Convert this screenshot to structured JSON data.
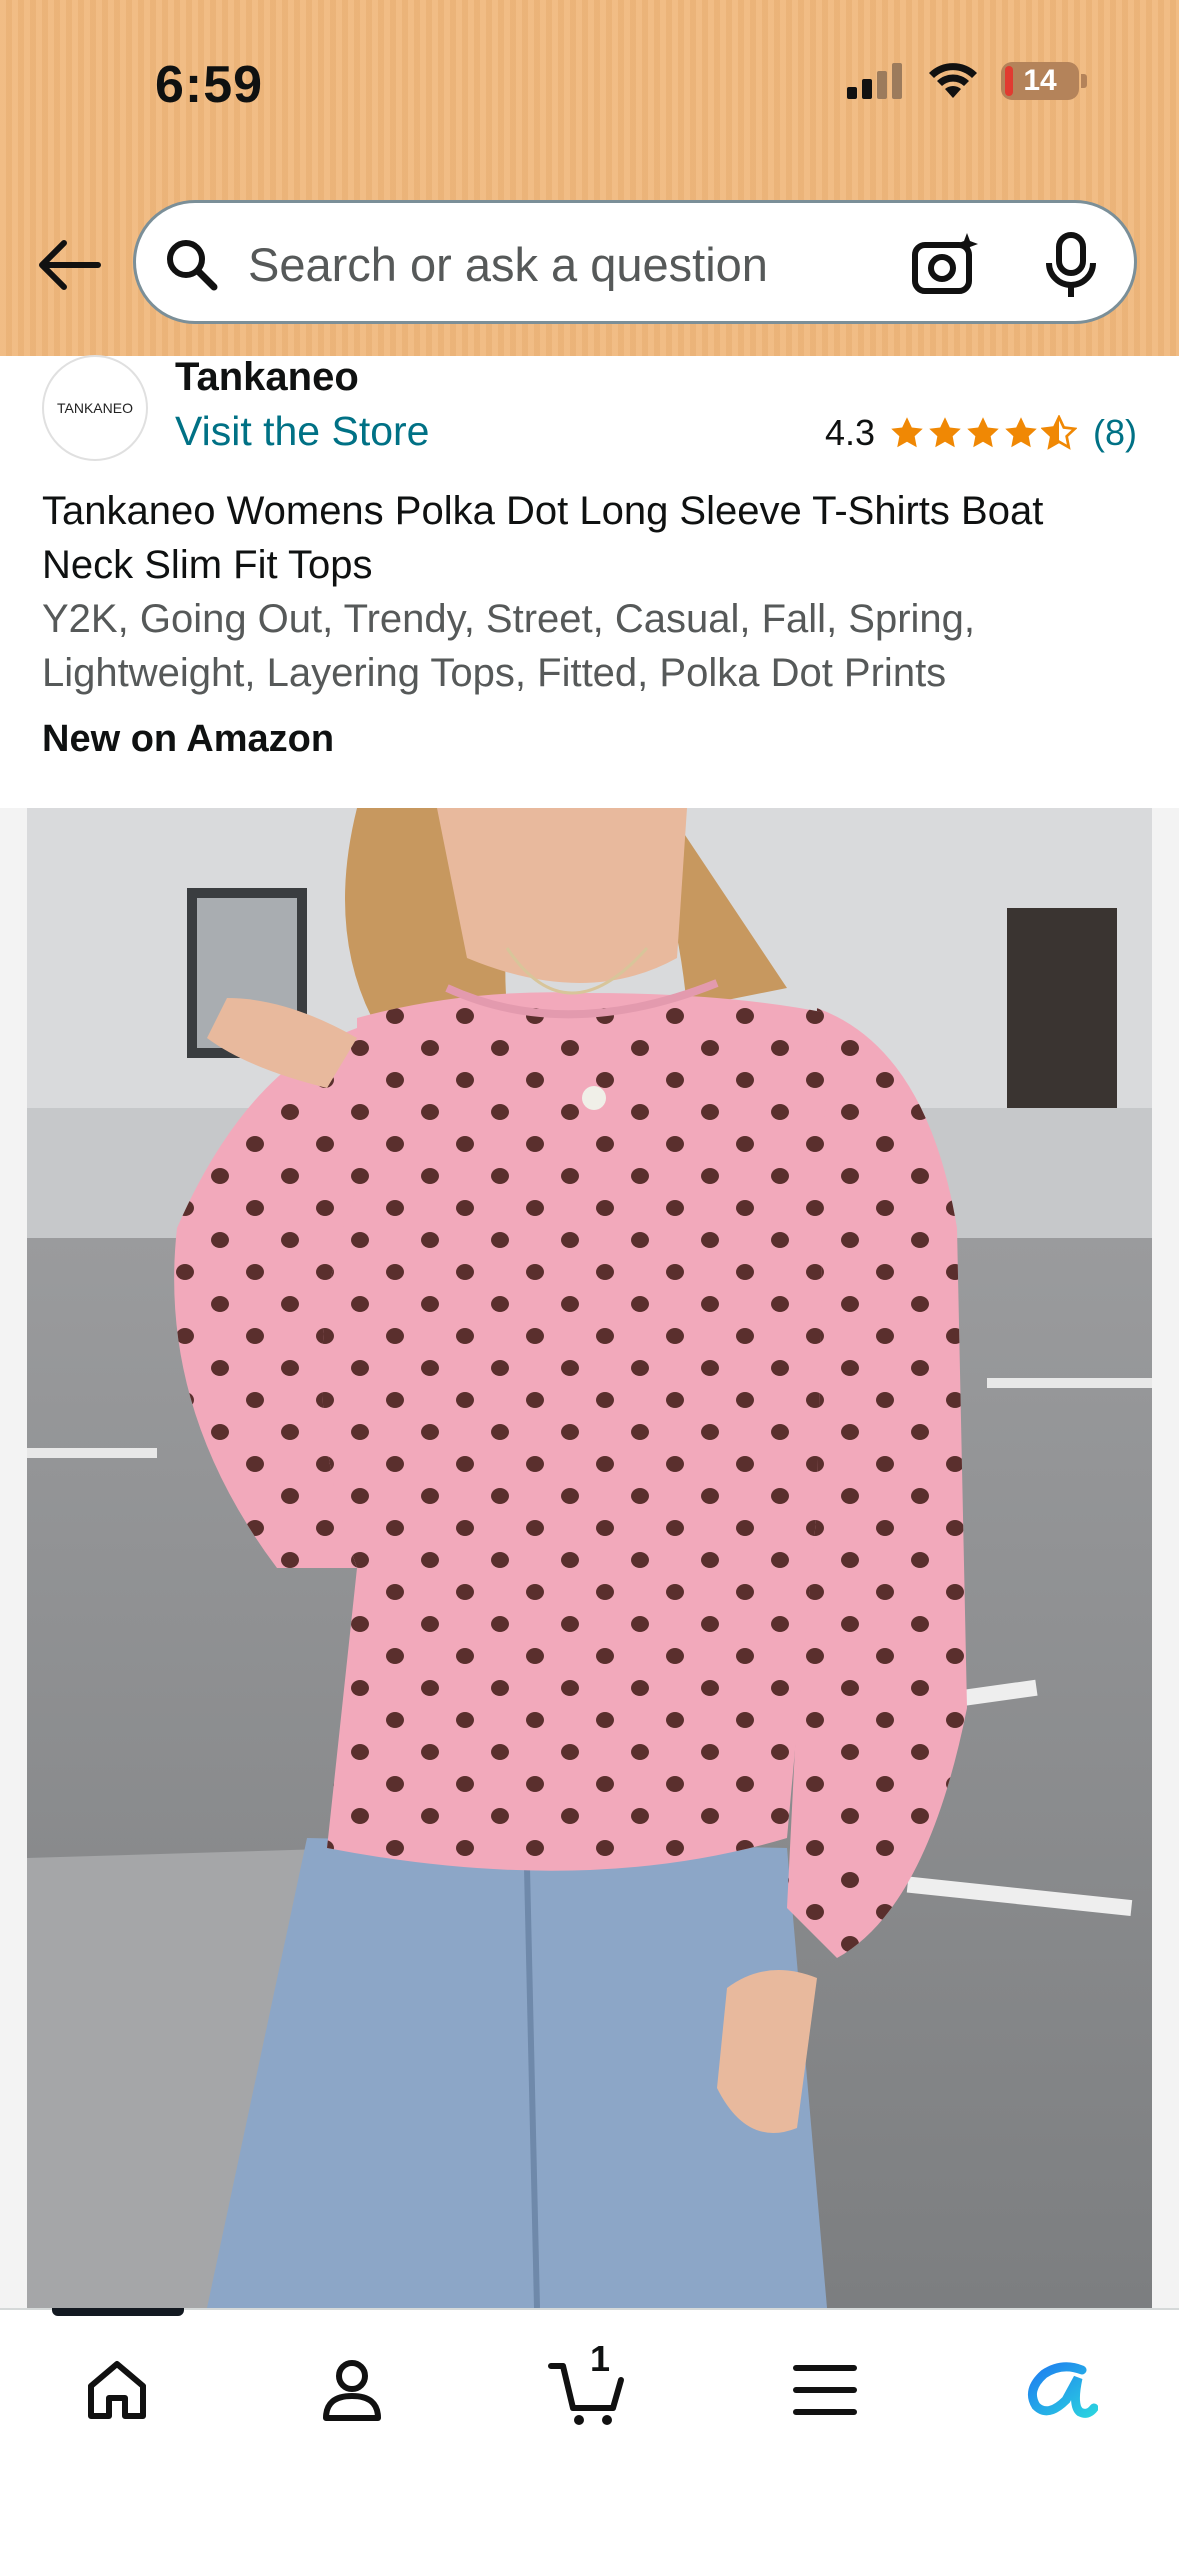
{
  "status_bar": {
    "time": "6:59",
    "battery": "14"
  },
  "search": {
    "placeholder": "Search or ask a question"
  },
  "store": {
    "name": "Tankaneo",
    "logo_text": "TANKANEO",
    "visit_label": "Visit the Store",
    "rating": "4.3",
    "rating_count": "(8)"
  },
  "product": {
    "title": "Tankaneo Womens Polka Dot Long Sleeve T-Shirts Boat Neck Slim Fit Tops",
    "tags": "Y2K, Going Out, Trendy, Street, Casual, Fall, Spring, Lightweight, Layering Tops, Fitted, Polka Dot Prints",
    "badge": "New on Amazon"
  },
  "nav": {
    "cart_count": "1"
  },
  "colors": {
    "header_bg": "#f0b77b",
    "link": "#007185",
    "star": "#f08804",
    "shirt": "#f2a9bb"
  }
}
